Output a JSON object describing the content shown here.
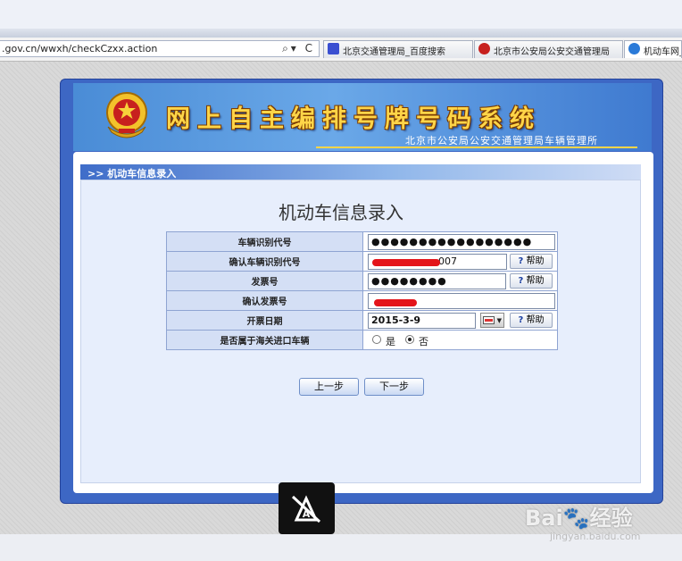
{
  "browser": {
    "address_text": ".gov.cn/wwxh/checkCzxx.action",
    "address_icons": "⌕▾ C",
    "tabs": [
      {
        "label": "北京交通管理局_百度搜索",
        "icon": "baidu-paw-icon",
        "color": "#3a4fd1"
      },
      {
        "label": "北京市公安局公安交通管理局",
        "icon": "police-emblem-icon",
        "color": "#c7201e"
      },
      {
        "label": "机动车网_",
        "icon": "ie-icon",
        "color": "#2a7ad8"
      }
    ]
  },
  "banner": {
    "title": "网上自主编排号牌号码系统",
    "subtitle": "北京市公安局公安交通管理局车辆管理所"
  },
  "breadcrumb": {
    "text": ">>  机动车信息录入"
  },
  "form": {
    "title": "机动车信息录入",
    "rows": [
      {
        "label": "车辆识别代号",
        "value": "●●●●●●●●●●●●●●●●●"
      },
      {
        "label": "确认车辆识别代号",
        "value": "007",
        "help": "帮助"
      },
      {
        "label": "发票号",
        "value": "●●●●●●●●",
        "help": "帮助"
      },
      {
        "label": "确认发票号",
        "value": ""
      },
      {
        "label": "开票日期",
        "value": "2015-3-9",
        "help": "帮助"
      },
      {
        "label": "是否属于海关进口车辆",
        "options": [
          "是",
          "否"
        ],
        "selected": "否"
      }
    ],
    "help_glyph": "?"
  },
  "buttons": {
    "prev": "上一步",
    "next": "下一步"
  },
  "watermark": {
    "brand": "Bai",
    "brand_cn": "经验",
    "url": "jingyan.baidu.com"
  },
  "colors": {
    "frame": "#3d67c4",
    "banner_title": "#ffd548",
    "label_bg": "#d4dff5",
    "redaction": "#e4141a"
  }
}
